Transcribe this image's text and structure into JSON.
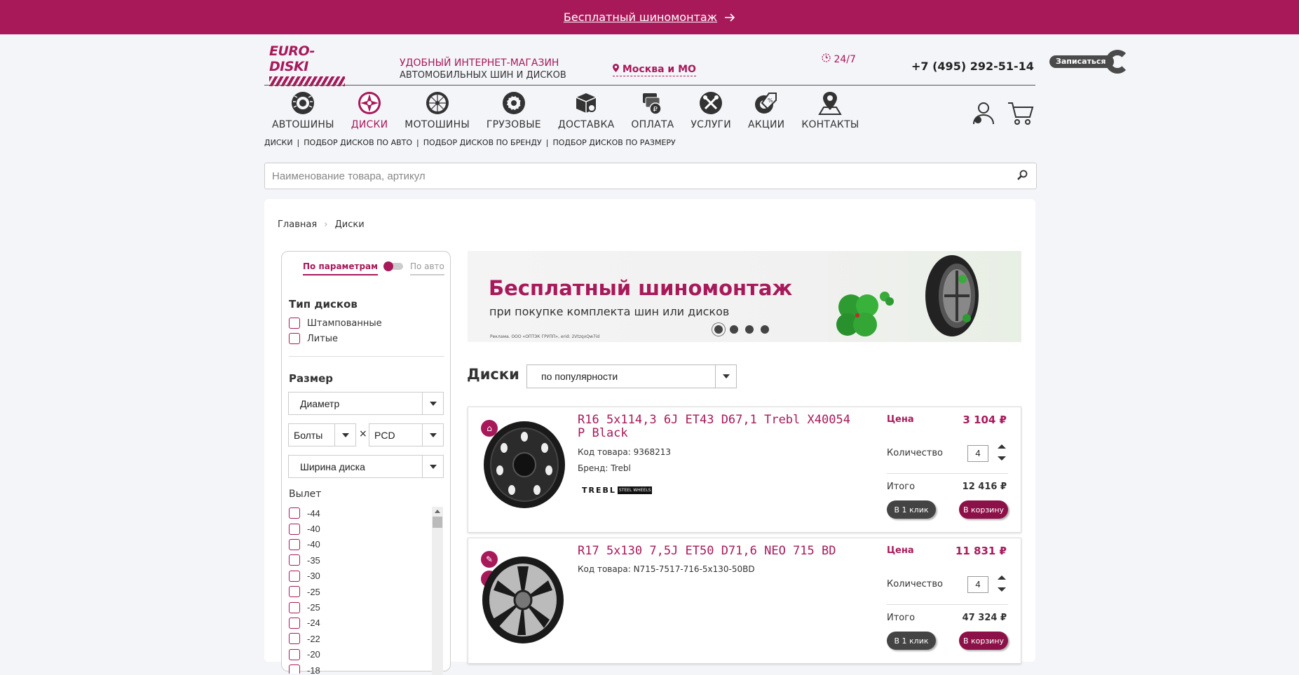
{
  "promo": {
    "text": "Бесплатный шиномонтаж"
  },
  "header": {
    "logo_text": "EURO-DISKI",
    "slogan_line1": "УДОБНЫЙ ИНТЕРНЕТ-МАГАЗИН",
    "slogan_line2": "АВТОМОБИЛЬНЫХ ШИН И ДИСКОВ",
    "city": "Москва и МО",
    "hours": "24/7",
    "phone": "+7 (495) 292-51-14",
    "signup": "Записаться"
  },
  "nav": {
    "items": [
      {
        "label": "АВТОШИНЫ"
      },
      {
        "label": "ДИСКИ"
      },
      {
        "label": "МОТОШИНЫ"
      },
      {
        "label": "ГРУЗОВЫЕ"
      },
      {
        "label": "ДОСТАВКА"
      },
      {
        "label": "ОПЛАТА"
      },
      {
        "label": "УСЛУГИ"
      },
      {
        "label": "АКЦИИ"
      },
      {
        "label": "КОНТАКТЫ"
      }
    ],
    "active": "ДИСКИ"
  },
  "subnav": [
    "ДИСКИ",
    "ПОДБОР ДИСКОВ ПО АВТО",
    "ПОДБОР ДИСКОВ ПО БРЕНДУ",
    "ПОДБОР ДИСКОВ ПО РАЗМЕРУ"
  ],
  "subnav_sep": "|",
  "search": {
    "placeholder": "Наименование товара, артикул"
  },
  "breadcrumb": {
    "home": "Главная",
    "current": "Диски"
  },
  "filter": {
    "tab_params": "По параметрам",
    "tab_auto": "По авто",
    "type_title": "Тип дисков",
    "type_options": [
      "Штампованные",
      "Литые"
    ],
    "size_title": "Размер",
    "diameter": "Диаметр",
    "bolts": "Болты",
    "times": "×",
    "pcd": "PCD",
    "width": "Ширина диска",
    "offset_title": "Вылет",
    "offsets": [
      "-44",
      "-40",
      "-40",
      "-35",
      "-30",
      "-25",
      "-25",
      "-24",
      "-22",
      "-20",
      "-18"
    ]
  },
  "banner": {
    "title": "Бесплатный шиномонтаж",
    "subtitle": "при покупке комплекта шин или дисков",
    "fineprint": "Реклама. ООО «ОПТЭК ГРУПП», erid: 2VtzqxQw7id",
    "slides": 4,
    "active_slide": 1
  },
  "listing": {
    "title": "Диски",
    "sort": "по популярности"
  },
  "products": [
    {
      "name": "R16 5x114,3 6J ET43 D67,1 Trebl X40054 P Black",
      "code_label": "Код товара:",
      "code": "9368213",
      "brand_label": "Бренд:",
      "brand": "Trebl",
      "brand_logo": "TREBL",
      "brand_logo_sub": "STEEL WHEELS",
      "price_label": "Цена",
      "price": "3 104 ₽",
      "qty_label": "Количество",
      "qty": "4",
      "total_label": "Итого",
      "total": "12 416 ₽",
      "oneclick": "В 1 клик",
      "tocart": "В корзину"
    },
    {
      "name": "R17 5x130 7,5J ET50 D71,6 NEO 715 BD",
      "code_label": "Код товара:",
      "code": "N715-7517-716-5x130-50BD",
      "price_label": "Цена",
      "price": "11 831 ₽",
      "qty_label": "Количество",
      "qty": "4",
      "total_label": "Итого",
      "total": "47 324 ₽",
      "oneclick": "В 1 клик",
      "tocart": "В корзину"
    }
  ],
  "colors": {
    "brand": "#a8195a",
    "dark": "#444444"
  }
}
